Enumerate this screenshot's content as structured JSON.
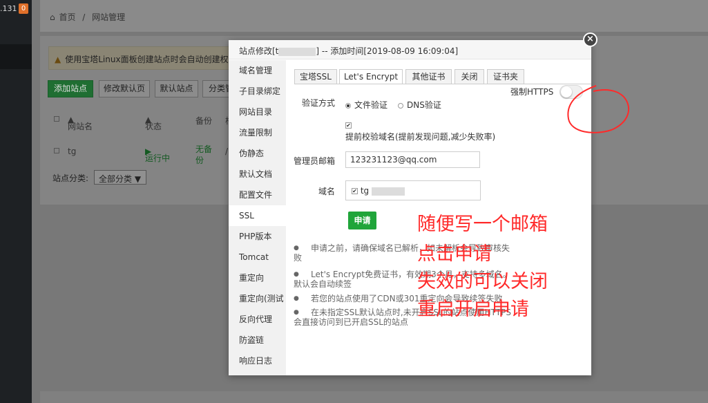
{
  "sidebar": {
    "ip_fragment": ".131",
    "badge": "0"
  },
  "breadcrumb": {
    "home": "首页",
    "sep": "/",
    "current": "网站管理"
  },
  "notice": {
    "text": "使用宝塔Linux面板创建站点时会自动创建权"
  },
  "toolbar": {
    "add_site": "添加站点",
    "edit_default_page": "修改默认页",
    "default_site": "默认站点",
    "category_mgmt": "分类管"
  },
  "table": {
    "headers": {
      "name": "网站名",
      "status": "状态",
      "backup": "备份",
      "extra": "根"
    },
    "row": {
      "name": "tg",
      "status": "运行中",
      "backup": "无备份",
      "extra": "/"
    }
  },
  "category": {
    "label": "站点分类:",
    "value": "全部分类"
  },
  "modal": {
    "title_prefix": "站点修改[t",
    "title_suffix": "] -- 添加时间[2019-08-09 16:09:04]",
    "close": "×",
    "side_items": [
      "域名管理",
      "子目录绑定",
      "网站目录",
      "流量限制",
      "伪静态",
      "默认文档",
      "配置文件",
      "SSL",
      "PHP版本",
      "Tomcat",
      "重定向",
      "重定向(测试",
      "反向代理",
      "防盗链",
      "响应日志"
    ],
    "tabs": [
      "宝塔SSL",
      "Let's Encrypt",
      "其他证书",
      "关闭",
      "证书夹"
    ],
    "force_https": "强制HTTPS",
    "verify_label": "验证方式",
    "verify_file": "文件验证",
    "verify_dns": "DNS验证",
    "precheck": "提前校验域名(提前发现问题,减少失败率)",
    "email_label": "管理员邮箱",
    "email_value": "123231123@qq.com",
    "domain_label": "域名",
    "domain_value": "tg",
    "apply": "申请",
    "notes": [
      "申请之前，请确保域名已解析，如未解析会导致审核失败",
      "Let's Encrypt免费证书，有效期3个月，支持多域名。默认会自动续签",
      "若您的站点使用了CDN或301重定向会导致续签失败",
      "在未指定SSL默认站点时,未开启SSL的站点使用HTTPS会直接访问到已开启SSL的站点"
    ]
  },
  "annotations": [
    "随便写一个邮箱",
    "点击申请",
    "失效的可以关闭",
    "重启开启申请"
  ],
  "colors": {
    "accent_green": "#20a53a",
    "annotation_red": "#ff2a2a"
  }
}
